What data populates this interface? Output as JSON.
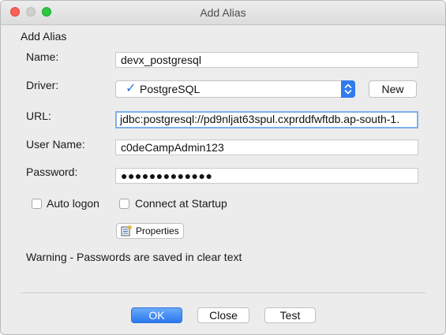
{
  "window": {
    "title": "Add Alias"
  },
  "form": {
    "header": "Add Alias",
    "name_label": "Name:",
    "name_value": "devx_postgresql",
    "driver_label": "Driver:",
    "driver_value": "PostgreSQL",
    "driver_selected_mark": "✓",
    "new_button": "New",
    "url_label": "URL:",
    "url_value": "jdbc:postgresql://pd9nljat63spul.cxprddfwftdb.ap-south-1.",
    "username_label": "User Name:",
    "username_value": "c0deCampAdmin123",
    "password_label": "Password:",
    "password_value": "●●●●●●●●●●●●●",
    "auto_logon_label": "Auto logon",
    "auto_logon_checked": false,
    "connect_startup_label": "Connect at Startup",
    "connect_startup_checked": false,
    "properties_button": "Properties",
    "warning": "Warning - Passwords are saved in clear text"
  },
  "buttons": {
    "ok": "OK",
    "close": "Close",
    "test": "Test"
  },
  "colors": {
    "accent": "#2b78ef",
    "close_light": "#fe5f57",
    "zoom_light": "#2ac840",
    "focus_ring": "#7fb0ea"
  }
}
